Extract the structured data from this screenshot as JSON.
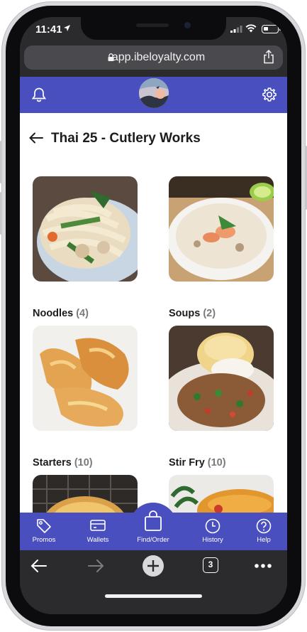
{
  "status_bar": {
    "time": "11:41"
  },
  "browser": {
    "url": "app.ibeloyalty.com",
    "tab_count": "3"
  },
  "header": {
    "title": "Thai 25 - Cutlery Works"
  },
  "categories": [
    {
      "name": "Noodles",
      "count": "(4)"
    },
    {
      "name": "Soups",
      "count": "(2)"
    },
    {
      "name": "Starters",
      "count": "(10)"
    },
    {
      "name": "Stir Fry",
      "count": "(10)"
    },
    {
      "name": "",
      "count": ""
    },
    {
      "name": "",
      "count": ""
    }
  ],
  "tabbar": {
    "promos": "Promos",
    "wallets": "Wallets",
    "find_order": "Find/Order",
    "history": "History",
    "help": "Help"
  },
  "colors": {
    "brand": "#4a4fbf",
    "browser_chrome": "#2b2b2e",
    "count_text": "#7a7a7a"
  }
}
